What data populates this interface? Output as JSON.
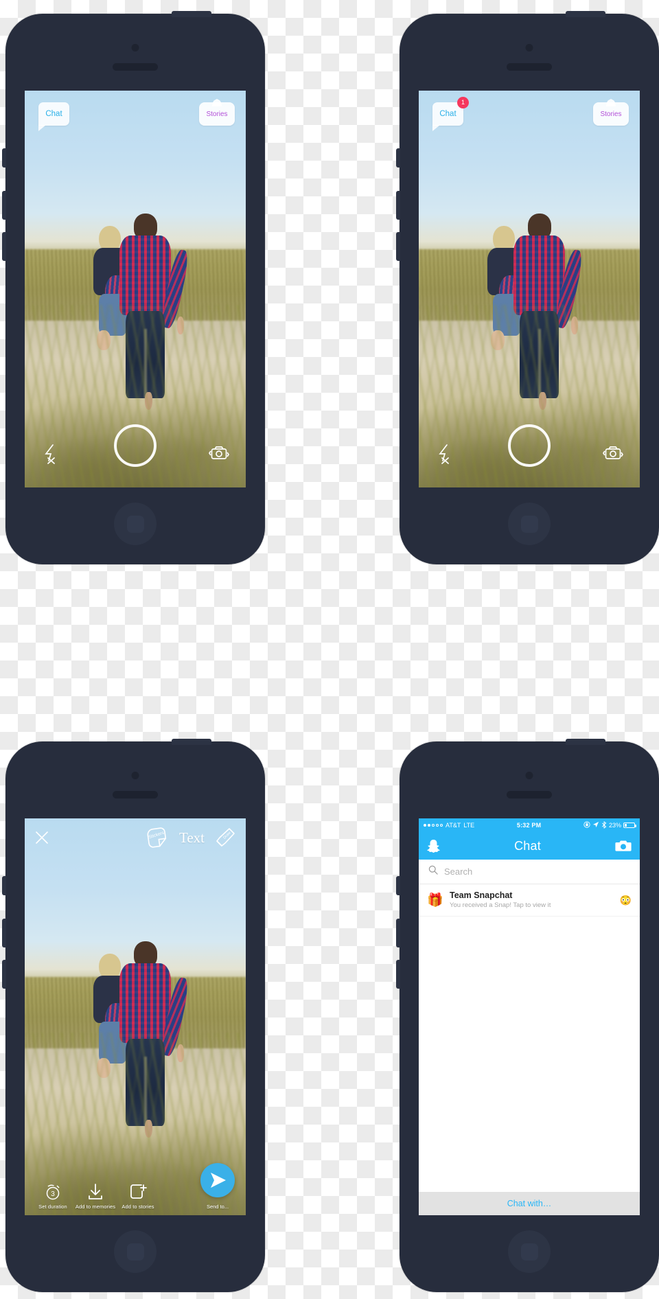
{
  "colors": {
    "frame": "#272d3d",
    "snap_blue": "#29b6f6",
    "chat_tab_text": "#2ab0e8",
    "stories_tab_text": "#b24fd8",
    "badge_red": "#f5375d",
    "send_blue": "#3ab0e8",
    "footer_grey": "#e2e2e2"
  },
  "phones": {
    "camera_default": {
      "label": "Camera screen without notification",
      "chat_tab": "Chat",
      "stories_tab": "Stories",
      "badge": null,
      "flash_icon": "flash-off-icon",
      "shutter_icon": "shutter-button",
      "flip_icon": "camera-flip-icon"
    },
    "camera_badged": {
      "label": "Camera screen with unread chat",
      "chat_tab": "Chat",
      "stories_tab": "Stories",
      "badge": "1",
      "flash_icon": "flash-off-icon",
      "shutter_icon": "shutter-button",
      "flip_icon": "camera-flip-icon"
    },
    "editor": {
      "label": "Snap editing screen",
      "close_icon": "close-icon",
      "stickers_label": "Stickers",
      "text_label": "Text",
      "draw_label": "Draw",
      "actions": [
        {
          "icon": "timer-icon",
          "value": "3",
          "label": "Set duration"
        },
        {
          "icon": "download-icon",
          "label": "Add to memories"
        },
        {
          "icon": "add-square-icon",
          "label": "Add to stories"
        }
      ],
      "send": {
        "icon": "send-icon",
        "label": "Send to..."
      }
    },
    "chat": {
      "label": "Chat list screen",
      "statusbar": {
        "carrier": "AT&T",
        "network": "LTE",
        "time": "5:32 PM",
        "battery_percent": "23%",
        "icons": [
          "rotation-lock-icon",
          "location-arrow-icon",
          "bluetooth-icon",
          "battery-icon"
        ]
      },
      "navbar": {
        "left_icon": "snapchat-ghost-icon",
        "title": "Chat",
        "right_icon": "camera-icon"
      },
      "search": {
        "icon": "search-icon",
        "placeholder": "Search",
        "value": ""
      },
      "rows": [
        {
          "avatar": "🎁",
          "name": "Team Snapchat",
          "subtitle": "You received a Snap! Tap to view it",
          "emoji": "😳"
        }
      ],
      "footer": "Chat with…"
    }
  }
}
